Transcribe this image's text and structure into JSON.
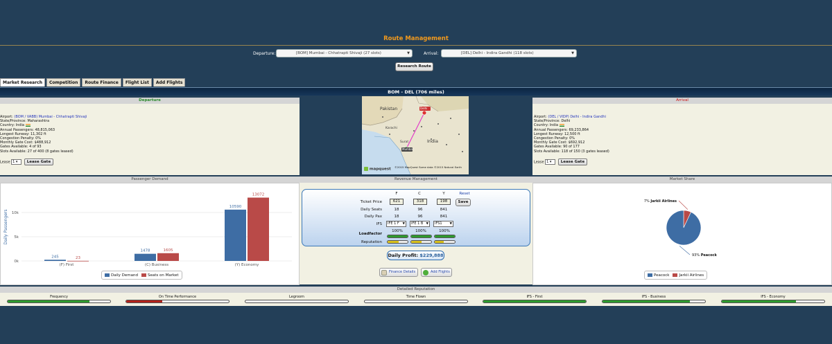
{
  "page": {
    "title": "Route Management"
  },
  "route_select": {
    "departure_label": "Departure:",
    "departure_value": "[BOM] Mumbai - Chhatrapti Shivaji (27 slots)",
    "arrival_label": "Arrival:",
    "arrival_value": "[DEL] Delhi - Indira Gandhi (118 slots)",
    "research_button": "Research Route"
  },
  "tabs": [
    {
      "label": "Market Research",
      "active": true
    },
    {
      "label": "Competition"
    },
    {
      "label": "Route Finance"
    },
    {
      "label": "Flight List"
    },
    {
      "label": "Add Flights"
    }
  ],
  "route_header": "BOM - DEL (706 miles)",
  "departure": {
    "title": "Departure",
    "airport_label": "Airport:",
    "airport": "(BOM / VABB) Mumbai - Chhatrapti Shivaji",
    "lines": [
      "State/Province: Maharashtra",
      "Country: India",
      "Annual Passengers: 48,815,063",
      "Longest Runway: 11,302 ft",
      "Congestion Penalty: 0%",
      "Monthly Gate Cost: $488,912",
      "Gates Available: 4 of 93",
      "Slots Available: 27 of 400 (8 gates leased)"
    ],
    "lease_label": "Lease",
    "lease_value": "1",
    "lease_button": "Lease Gate"
  },
  "arrival": {
    "title": "Arrival",
    "airport_label": "Airport:",
    "airport": "(DEL / VIDP) Delhi - Indira Gandhi",
    "lines": [
      "State/Province: Delhi",
      "Country: India",
      "Annual Passengers: 69,233,864",
      "Longest Runway: 12,500 ft",
      "Congestion Penalty: 0%",
      "Monthly Gate Cost: $692,912",
      "Gates Available: 90 of 177",
      "Slots Available: 118 of 150 (3 gates leased)"
    ],
    "lease_label": "Lease",
    "lease_value": "1",
    "lease_button": "Lease Gate"
  },
  "map": {
    "labels": [
      "Pakistan",
      "Karachi",
      "India",
      "Surat",
      "Delhi",
      "Mumbai"
    ],
    "brand": "mapquest",
    "credit": "©2015 MapQuest Some data ©2015 Natural Earth"
  },
  "passenger_demand": {
    "title": "Passenger Demand",
    "legend": [
      "Daily Demand",
      "Seats on Market"
    ]
  },
  "revenue_management": {
    "title": "Revenue Management",
    "classes": [
      "F",
      "C",
      "Y"
    ],
    "reset": "Reset",
    "save": "Save",
    "ticket_price_label": "Ticket Price",
    "ticket_prices": [
      "621",
      "318",
      "198"
    ],
    "daily_seats_label": "Daily Seats",
    "daily_seats": [
      "18",
      "96",
      "841"
    ],
    "daily_pax_label": "Daily Pax",
    "daily_pax": [
      "18",
      "96",
      "841"
    ],
    "ifs_label": "IFS",
    "ifs": [
      "IFE 1 F",
      "IFE 1 B",
      "IFS1"
    ],
    "loadfactor_label": "Loadfactor",
    "loadfactor": [
      "100%",
      "100%",
      "100%"
    ],
    "loadfactor_fill": [
      1.0,
      1.0,
      1.0
    ],
    "reputation_label": "Reputation",
    "reputation_fill": [
      0.55,
      0.5,
      0.45
    ],
    "profit_label": "Daily Profit:",
    "profit_value": "$229,888",
    "finance_button": "Finance Details",
    "add_flights_button": "Add Flights"
  },
  "market_share": {
    "title": "Market Share",
    "slices": [
      {
        "label": "Jarkii Airlines",
        "pct_label": "7%",
        "value": 7,
        "color": "#b94a48"
      },
      {
        "label": "Peacock",
        "pct_label": "93%",
        "value": 93,
        "color": "#3e6da4"
      }
    ],
    "legend": [
      "Peacock",
      "Jarkii Airlines"
    ]
  },
  "reputation": {
    "title": "Detailed Reputation",
    "items": [
      {
        "label": "Frequency",
        "fill": 0.8,
        "color": "#2d9a2d"
      },
      {
        "label": "On Time Performance",
        "fill": 0.35,
        "color": "#b3221a"
      },
      {
        "label": "Legroom",
        "fill": 0.0,
        "color": "#2d9a2d"
      },
      {
        "label": "Time Flown",
        "fill": 0.0,
        "color": "#2d9a2d"
      },
      {
        "label": "IFS - First",
        "fill": 1.0,
        "color": "#2d9a2d"
      },
      {
        "label": "IFS - Business",
        "fill": 0.85,
        "color": "#2d9a2d"
      },
      {
        "label": "IFS - Economy",
        "fill": 0.72,
        "color": "#2d9a2d"
      }
    ]
  },
  "chart_data": {
    "type": "bar",
    "categories": [
      "(F) First",
      "(C) Business",
      "(Y) Economy"
    ],
    "series": [
      {
        "name": "Daily Demand",
        "values": [
          245,
          1478,
          10590
        ],
        "color": "#3e6da4"
      },
      {
        "name": "Seats on Market",
        "values": [
          23,
          1605,
          13072
        ],
        "color": "#b94a48"
      }
    ],
    "ylabel": "Daily Passengers",
    "yticks": [
      "0k",
      "5k",
      "10k"
    ],
    "ylim": [
      0,
      14000
    ]
  }
}
